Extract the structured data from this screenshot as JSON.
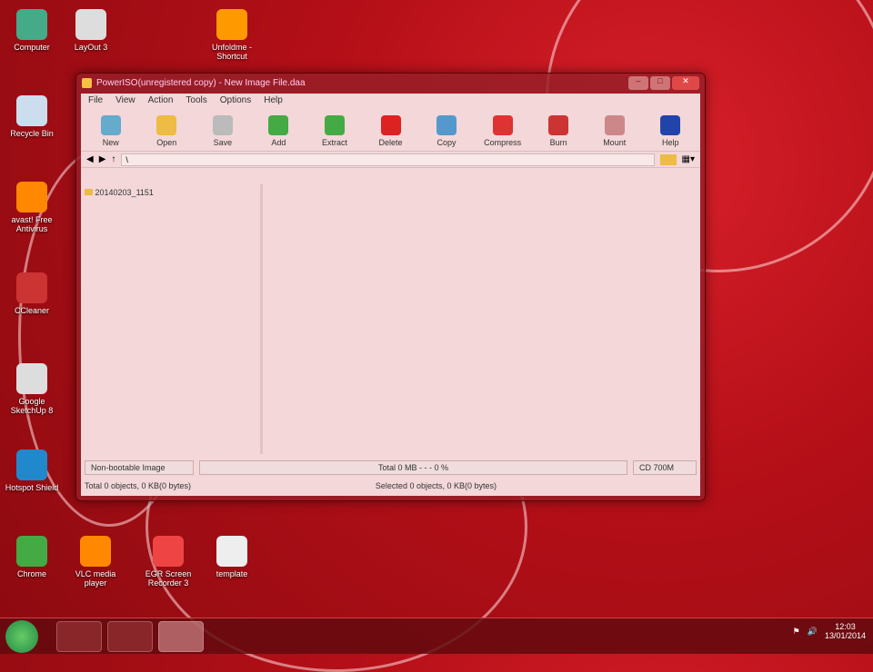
{
  "desktop": {
    "icons": [
      {
        "label": "Computer",
        "color": "#4a8"
      },
      {
        "label": "LayOut 3",
        "color": "#ddd"
      },
      {
        "label": "Unfoldme - Shortcut",
        "color": "#f90"
      },
      {
        "label": "Recycle Bin",
        "color": "#cde"
      },
      {
        "label": "avast! Free Antivirus",
        "color": "#f80"
      },
      {
        "label": "CCleaner",
        "color": "#c33"
      },
      {
        "label": "Google SketchUp 8",
        "color": "#ddd"
      },
      {
        "label": "Hotspot Shield",
        "color": "#28c"
      },
      {
        "label": "Chrome",
        "color": "#4a4"
      },
      {
        "label": "VLC media player",
        "color": "#f80"
      },
      {
        "label": "EGR Screen Recorder 3",
        "color": "#e44"
      },
      {
        "label": "template",
        "color": "#eee"
      }
    ]
  },
  "window": {
    "title": "PowerISO(unregistered copy) - New Image File.daa",
    "menu": [
      "File",
      "View",
      "Action",
      "Tools",
      "Options",
      "Help"
    ],
    "toolbar": [
      {
        "label": "New",
        "color": "#6ac"
      },
      {
        "label": "Open",
        "color": "#eb4"
      },
      {
        "label": "Save",
        "color": "#bbb"
      },
      {
        "label": "Add",
        "color": "#4a4"
      },
      {
        "label": "Extract",
        "color": "#4a4"
      },
      {
        "label": "Delete",
        "color": "#d22"
      },
      {
        "label": "Copy",
        "color": "#59c"
      },
      {
        "label": "Compress",
        "color": "#d33"
      },
      {
        "label": "Burn",
        "color": "#c33"
      },
      {
        "label": "Mount",
        "color": "#c88"
      },
      {
        "label": "Help",
        "color": "#24a"
      }
    ],
    "address": "\\",
    "tree_item": "20140203_1151",
    "status_image_type": "Non-bootable Image",
    "status_total": "Total 0 MB  - - - 0 %",
    "status_media": "CD 700M",
    "status_left": "Total 0 objects, 0 KB(0 bytes)",
    "status_center": "Selected 0 objects, 0 KB(0 bytes)"
  },
  "taskbar": {
    "time": "12:03",
    "date": "13/01/2014"
  }
}
